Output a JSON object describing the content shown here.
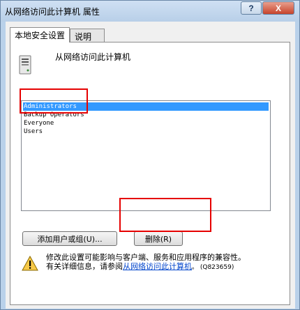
{
  "window": {
    "title": "从网络访问此计算机 属性",
    "help_label": "?",
    "close_label": "X"
  },
  "tabs": [
    {
      "label": "本地安全设置",
      "active": true
    },
    {
      "label": "说明",
      "active": false
    }
  ],
  "policy": {
    "name": "从网络访问此计算机",
    "icon": "computer-icon"
  },
  "accounts": [
    {
      "name": "Administrators",
      "selected": true
    },
    {
      "name": "Backup Operators",
      "selected": false
    },
    {
      "name": "Everyone",
      "selected": false
    },
    {
      "name": "Users",
      "selected": false
    }
  ],
  "buttons": {
    "add": "添加用户或组(U)...",
    "remove": "删除(R)"
  },
  "warning": {
    "icon": "warning-icon",
    "line1": "修改此设置可能影响与客户端、服务和应用程序的兼容性。",
    "line2_prefix": "有关详细信息，请参阅",
    "link": "从网络访问此计算机",
    "kb": "。 (Q823659)"
  },
  "colors": {
    "selection": "#3399ff",
    "annotation": "#e60000",
    "link": "#0044cc"
  }
}
